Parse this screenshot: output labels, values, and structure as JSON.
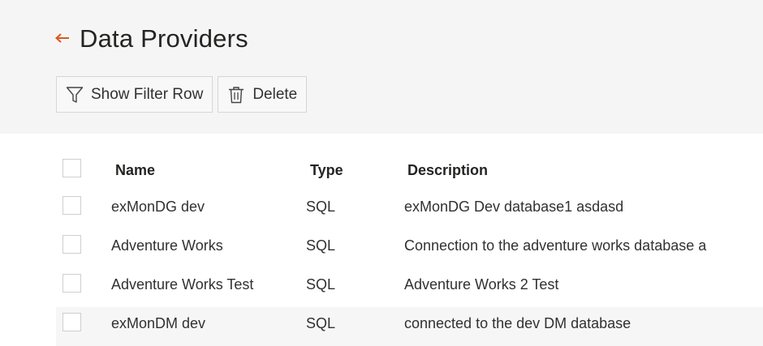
{
  "page": {
    "title": "Data Providers",
    "back_icon": "back-arrow-icon",
    "accent_color": "#d85a1e"
  },
  "toolbar": {
    "filter_label": "Show Filter Row",
    "filter_icon": "filter-icon",
    "delete_label": "Delete",
    "delete_icon": "trash-icon"
  },
  "table": {
    "columns": {
      "name": "Name",
      "type": "Type",
      "description": "Description"
    },
    "rows": [
      {
        "name": "exMonDG dev",
        "type": "SQL",
        "description": "exMonDG Dev database1 asdasd"
      },
      {
        "name": "Adventure Works",
        "type": "SQL",
        "description": "Connection to the adventure works database a"
      },
      {
        "name": "Adventure Works Test",
        "type": "SQL",
        "description": "Adventure Works 2 Test"
      },
      {
        "name": "exMonDM dev",
        "type": "SQL",
        "description": "connected to the dev DM database"
      }
    ]
  }
}
